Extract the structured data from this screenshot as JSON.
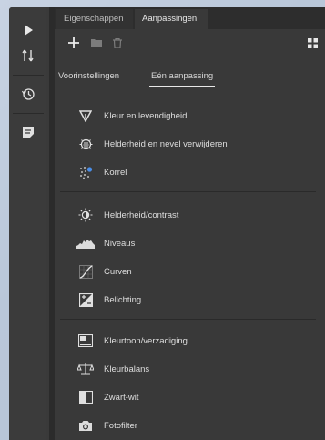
{
  "panel": {
    "tabs": [
      {
        "label": "Eigenschappen",
        "active": false
      },
      {
        "label": "Aanpassingen",
        "active": true
      }
    ],
    "toolbar_icons": [
      "plus-icon",
      "folder-icon",
      "trash-icon",
      "grid-view-icon"
    ],
    "subtabs": [
      {
        "label": "Voorinstellingen",
        "active": false
      },
      {
        "label": "Eén aanpassing",
        "active": true
      }
    ],
    "groups": [
      {
        "items": [
          {
            "icon": "color-vibrance-icon",
            "label": "Kleur en levendigheid"
          },
          {
            "icon": "haze-removal-icon",
            "label": "Helderheid en nevel verwijderen"
          },
          {
            "icon": "grain-icon",
            "label": "Korrel"
          }
        ]
      },
      {
        "items": [
          {
            "icon": "brightness-contrast-icon",
            "label": "Helderheid/contrast"
          },
          {
            "icon": "levels-icon",
            "label": "Niveaus"
          },
          {
            "icon": "curves-icon",
            "label": "Curven"
          },
          {
            "icon": "exposure-icon",
            "label": "Belichting"
          }
        ]
      },
      {
        "items": [
          {
            "icon": "hue-saturation-icon",
            "label": "Kleurtoon/verzadiging"
          },
          {
            "icon": "color-balance-icon",
            "label": "Kleurbalans"
          },
          {
            "icon": "black-white-icon",
            "label": "Zwart-wit"
          },
          {
            "icon": "photo-filter-icon",
            "label": "Fotofilter"
          }
        ]
      }
    ]
  },
  "sidebar": {
    "tools": [
      "play-icon",
      "adjust-tool-icon",
      "history-icon",
      "note-icon"
    ]
  }
}
